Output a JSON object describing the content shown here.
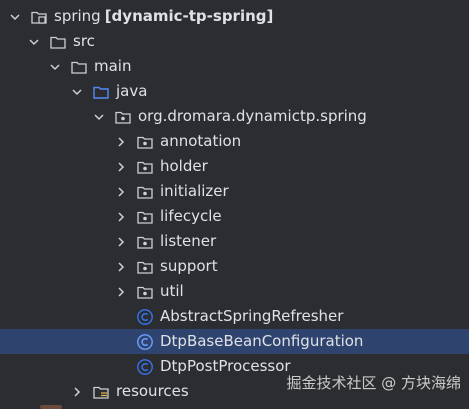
{
  "tree": {
    "rows": [
      {
        "label": "spring",
        "suffix": "[dynamic-tp-spring]",
        "icon": "module-folder-icon",
        "expanded": true
      },
      {
        "label": "src",
        "icon": "folder-icon",
        "expanded": true
      },
      {
        "label": "main",
        "icon": "folder-icon",
        "expanded": true
      },
      {
        "label": "java",
        "icon": "source-root-folder-icon",
        "expanded": true
      },
      {
        "label": "org.dromara.dynamictp.spring",
        "icon": "package-icon",
        "expanded": true
      },
      {
        "label": "annotation",
        "icon": "package-icon",
        "expanded": false
      },
      {
        "label": "holder",
        "icon": "package-icon",
        "expanded": false
      },
      {
        "label": "initializer",
        "icon": "package-icon",
        "expanded": false
      },
      {
        "label": "lifecycle",
        "icon": "package-icon",
        "expanded": false
      },
      {
        "label": "listener",
        "icon": "package-icon",
        "expanded": false
      },
      {
        "label": "support",
        "icon": "package-icon",
        "expanded": false
      },
      {
        "label": "util",
        "icon": "package-icon",
        "expanded": false
      },
      {
        "label": "AbstractSpringRefresher",
        "icon": "class-icon"
      },
      {
        "label": "DtpBaseBeanConfiguration",
        "icon": "class-icon",
        "selected": true
      },
      {
        "label": "DtpPostProcessor",
        "icon": "class-icon"
      },
      {
        "label": "resources",
        "icon": "resources-folder-icon",
        "expanded": false
      }
    ]
  },
  "watermark": "掘金技术社区 @ 方块海绵",
  "colors": {
    "background": "#2b2d30",
    "selection": "#2e436e",
    "text": "#dfe1e5",
    "folder_outline": "#ced0d6",
    "source_root": "#548af7",
    "class_icon": "#3574f0"
  }
}
